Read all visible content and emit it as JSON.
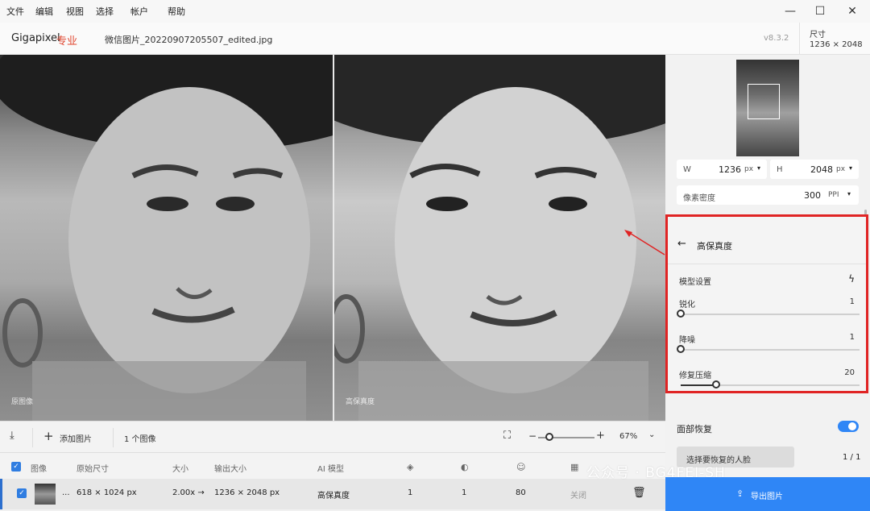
{
  "menu": [
    "文件",
    "编辑",
    "视图",
    "选择",
    "帐户",
    "帮助"
  ],
  "window_controls": {
    "minimize": "—",
    "maximize": "☐",
    "close": "✕"
  },
  "header": {
    "app_name": "Gigapixel",
    "app_edition": "专业",
    "file_name": "微信图片_20220907205507_edited.jpg",
    "version": "v8.3.2",
    "size_label": "尺寸",
    "size_value": "1236 × 2048"
  },
  "panes": {
    "original_label": "原图像",
    "enhanced_label": "高保真度"
  },
  "toolbar": {
    "add_image": "添加图片",
    "image_count": "1 个图像",
    "zoom": "67%",
    "zoom_level_fraction": 0.2
  },
  "table": {
    "headers": [
      "图像",
      "原始尺寸",
      "大小",
      "输出大小",
      "AI 模型"
    ],
    "row": {
      "ellipsis": "...",
      "original_size": "618 × 1024 px",
      "scale": "2.00x →",
      "output_size": "1236 × 2048 px",
      "model": "高保真度",
      "v1": "1",
      "v2": "1",
      "v3": "80",
      "v4": "关闭"
    }
  },
  "right_panel": {
    "w_label": "W",
    "w_value": "1236",
    "w_unit": "px",
    "h_label": "H",
    "h_value": "2048",
    "h_unit": "px",
    "ppi_label": "像素密度",
    "ppi_value": "300",
    "ppi_unit": "PPI",
    "fidelity_title": "高保真度",
    "model_settings": "模型设置",
    "sliders": [
      {
        "label": "锐化",
        "value": "1",
        "fraction": 0.0
      },
      {
        "label": "降噪",
        "value": "1",
        "fraction": 0.0
      },
      {
        "label": "修复压缩",
        "value": "20",
        "fraction": 0.2
      }
    ],
    "face_recovery": "面部恢复",
    "face_recovery_on": true,
    "select_faces": "选择要恢复的人脸",
    "face_count": "1 / 1",
    "export": "导出图片"
  },
  "watermark": "公众号 · BG4FEI-SH",
  "colors": {
    "accent": "#2f86f6",
    "highlight": "#e02424",
    "edition": "#e0462f"
  }
}
